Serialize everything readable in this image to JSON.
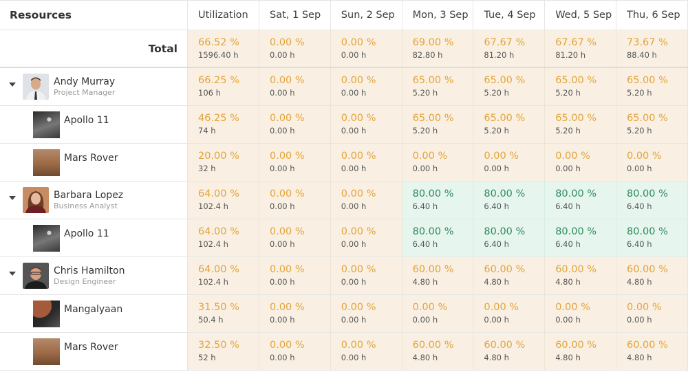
{
  "header": {
    "resources_label": "Resources",
    "columns": [
      "Utilization",
      "Sat, 1 Sep",
      "Sun, 2 Sep",
      "Mon, 3 Sep",
      "Tue, 4 Sep",
      "Wed, 5 Sep",
      "Thu, 6 Sep"
    ]
  },
  "total": {
    "label": "Total",
    "cells": [
      {
        "pct": "66.52 %",
        "hrs": "1596.40 h"
      },
      {
        "pct": "0.00 %",
        "hrs": "0.00 h"
      },
      {
        "pct": "0.00 %",
        "hrs": "0.00 h"
      },
      {
        "pct": "69.00 %",
        "hrs": "82.80 h"
      },
      {
        "pct": "67.67 %",
        "hrs": "81.20 h"
      },
      {
        "pct": "67.67 %",
        "hrs": "81.20 h"
      },
      {
        "pct": "73.67 %",
        "hrs": "88.40 h"
      }
    ]
  },
  "rows": [
    {
      "type": "person",
      "name": "Andy Murray",
      "role": "Project Manager",
      "avatar": "andy-avatar",
      "cells": [
        {
          "pct": "66.25 %",
          "hrs": "106 h",
          "status": "under"
        },
        {
          "pct": "0.00 %",
          "hrs": "0.00 h",
          "status": "under"
        },
        {
          "pct": "0.00 %",
          "hrs": "0.00 h",
          "status": "under"
        },
        {
          "pct": "65.00 %",
          "hrs": "5.20 h",
          "status": "under"
        },
        {
          "pct": "65.00 %",
          "hrs": "5.20 h",
          "status": "under"
        },
        {
          "pct": "65.00 %",
          "hrs": "5.20 h",
          "status": "under"
        },
        {
          "pct": "65.00 %",
          "hrs": "5.20 h",
          "status": "under"
        }
      ]
    },
    {
      "type": "project",
      "name": "Apollo 11",
      "thumb": "apollo-thumbnail",
      "cells": [
        {
          "pct": "46.25 %",
          "hrs": "74 h",
          "status": "under"
        },
        {
          "pct": "0.00 %",
          "hrs": "0.00 h",
          "status": "under"
        },
        {
          "pct": "0.00 %",
          "hrs": "0.00 h",
          "status": "under"
        },
        {
          "pct": "65.00 %",
          "hrs": "5.20 h",
          "status": "under"
        },
        {
          "pct": "65.00 %",
          "hrs": "5.20 h",
          "status": "under"
        },
        {
          "pct": "65.00 %",
          "hrs": "5.20 h",
          "status": "under"
        },
        {
          "pct": "65.00 %",
          "hrs": "5.20 h",
          "status": "under"
        }
      ]
    },
    {
      "type": "project",
      "name": "Mars Rover",
      "thumb": "mars-rover-thumbnail",
      "cells": [
        {
          "pct": "20.00 %",
          "hrs": "32 h",
          "status": "under"
        },
        {
          "pct": "0.00 %",
          "hrs": "0.00 h",
          "status": "under"
        },
        {
          "pct": "0.00 %",
          "hrs": "0.00 h",
          "status": "under"
        },
        {
          "pct": "0.00 %",
          "hrs": "0.00 h",
          "status": "under"
        },
        {
          "pct": "0.00 %",
          "hrs": "0.00 h",
          "status": "under"
        },
        {
          "pct": "0.00 %",
          "hrs": "0.00 h",
          "status": "under"
        },
        {
          "pct": "0.00 %",
          "hrs": "0.00 h",
          "status": "under"
        }
      ]
    },
    {
      "type": "person",
      "name": "Barbara Lopez",
      "role": "Business Analyst",
      "avatar": "barbara-avatar",
      "cells": [
        {
          "pct": "64.00 %",
          "hrs": "102.4 h",
          "status": "under"
        },
        {
          "pct": "0.00 %",
          "hrs": "0.00 h",
          "status": "under"
        },
        {
          "pct": "0.00 %",
          "hrs": "0.00 h",
          "status": "under"
        },
        {
          "pct": "80.00 %",
          "hrs": "6.40 h",
          "status": "optimal"
        },
        {
          "pct": "80.00 %",
          "hrs": "6.40 h",
          "status": "optimal"
        },
        {
          "pct": "80.00 %",
          "hrs": "6.40 h",
          "status": "optimal"
        },
        {
          "pct": "80.00 %",
          "hrs": "6.40 h",
          "status": "optimal"
        }
      ]
    },
    {
      "type": "project",
      "name": "Apollo 11",
      "thumb": "apollo-thumbnail",
      "cells": [
        {
          "pct": "64.00 %",
          "hrs": "102.4 h",
          "status": "under"
        },
        {
          "pct": "0.00 %",
          "hrs": "0.00 h",
          "status": "under"
        },
        {
          "pct": "0.00 %",
          "hrs": "0.00 h",
          "status": "under"
        },
        {
          "pct": "80.00 %",
          "hrs": "6.40 h",
          "status": "optimal"
        },
        {
          "pct": "80.00 %",
          "hrs": "6.40 h",
          "status": "optimal"
        },
        {
          "pct": "80.00 %",
          "hrs": "6.40 h",
          "status": "optimal"
        },
        {
          "pct": "80.00 %",
          "hrs": "6.40 h",
          "status": "optimal"
        }
      ]
    },
    {
      "type": "person",
      "name": "Chris Hamilton",
      "role": "Design Engineer",
      "avatar": "chris-avatar",
      "cells": [
        {
          "pct": "64.00 %",
          "hrs": "102.4 h",
          "status": "under"
        },
        {
          "pct": "0.00 %",
          "hrs": "0.00 h",
          "status": "under"
        },
        {
          "pct": "0.00 %",
          "hrs": "0.00 h",
          "status": "under"
        },
        {
          "pct": "60.00 %",
          "hrs": "4.80 h",
          "status": "under"
        },
        {
          "pct": "60.00 %",
          "hrs": "4.80 h",
          "status": "under"
        },
        {
          "pct": "60.00 %",
          "hrs": "4.80 h",
          "status": "under"
        },
        {
          "pct": "60.00 %",
          "hrs": "4.80 h",
          "status": "under"
        }
      ]
    },
    {
      "type": "project",
      "name": "Mangalyaan",
      "thumb": "mangalyaan-thumbnail",
      "cells": [
        {
          "pct": "31.50 %",
          "hrs": "50.4 h",
          "status": "under"
        },
        {
          "pct": "0.00 %",
          "hrs": "0.00 h",
          "status": "under"
        },
        {
          "pct": "0.00 %",
          "hrs": "0.00 h",
          "status": "under"
        },
        {
          "pct": "0.00 %",
          "hrs": "0.00 h",
          "status": "under"
        },
        {
          "pct": "0.00 %",
          "hrs": "0.00 h",
          "status": "under"
        },
        {
          "pct": "0.00 %",
          "hrs": "0.00 h",
          "status": "under"
        },
        {
          "pct": "0.00 %",
          "hrs": "0.00 h",
          "status": "under"
        }
      ]
    },
    {
      "type": "project",
      "name": "Mars Rover",
      "thumb": "mars-rover-thumbnail",
      "cells": [
        {
          "pct": "32.50 %",
          "hrs": "52 h",
          "status": "under"
        },
        {
          "pct": "0.00 %",
          "hrs": "0.00 h",
          "status": "under"
        },
        {
          "pct": "0.00 %",
          "hrs": "0.00 h",
          "status": "under"
        },
        {
          "pct": "60.00 %",
          "hrs": "4.80 h",
          "status": "under"
        },
        {
          "pct": "60.00 %",
          "hrs": "4.80 h",
          "status": "under"
        },
        {
          "pct": "60.00 %",
          "hrs": "4.80 h",
          "status": "under"
        },
        {
          "pct": "60.00 %",
          "hrs": "4.80 h",
          "status": "under"
        }
      ]
    }
  ],
  "colors": {
    "under_text": "#e3a43a",
    "under_bg": "#f9f0e3",
    "optimal_text": "#2f8a5c",
    "optimal_bg": "#e6f6ef"
  }
}
